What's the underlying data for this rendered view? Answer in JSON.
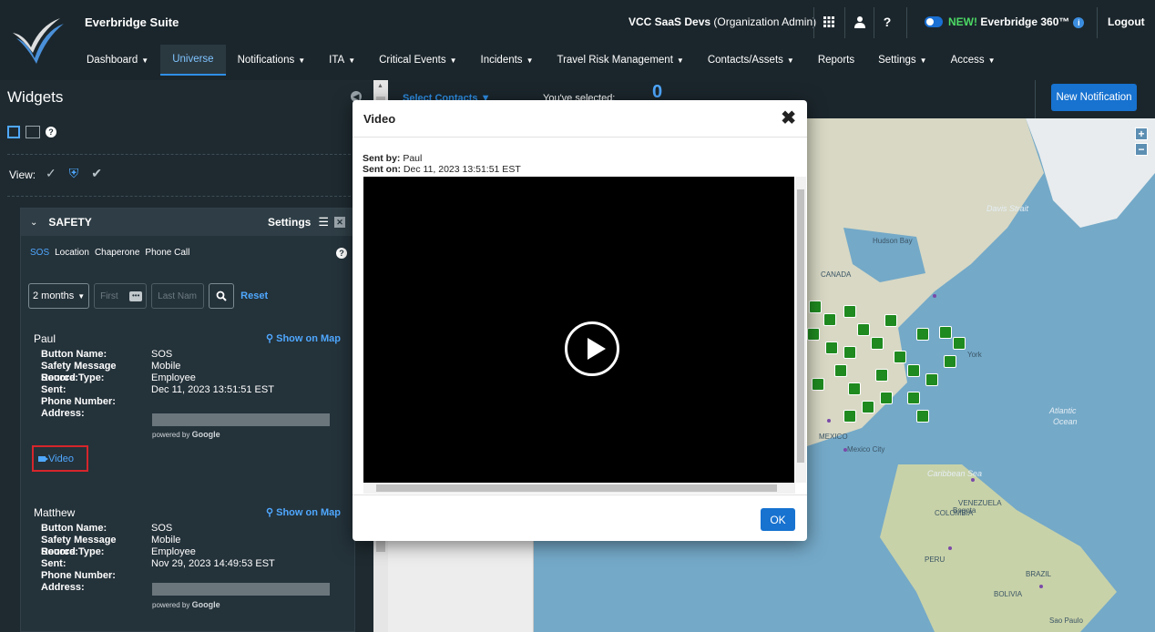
{
  "header": {
    "suite": "Everbridge Suite",
    "org_name": "VCC SaaS Devs",
    "org_role": "(Organization Admin)",
    "new_label": "NEW!",
    "product_360": "Everbridge 360™",
    "logout": "Logout"
  },
  "nav": {
    "items": [
      {
        "label": "Dashboard",
        "caret": true
      },
      {
        "label": "Universe",
        "caret": false,
        "active": true
      },
      {
        "label": "Notifications",
        "caret": true
      },
      {
        "label": "ITA",
        "caret": true
      },
      {
        "label": "Critical Events",
        "caret": true
      },
      {
        "label": "Incidents",
        "caret": true
      },
      {
        "label": "Travel Risk Management",
        "caret": true
      },
      {
        "label": "Contacts/Assets",
        "caret": true
      },
      {
        "label": "Reports",
        "caret": false
      },
      {
        "label": "Settings",
        "caret": true
      },
      {
        "label": "Access",
        "caret": true
      }
    ]
  },
  "widgets": {
    "title": "Widgets",
    "view_label": "View:"
  },
  "safety": {
    "title": "SAFETY",
    "settings": "Settings",
    "tabs": [
      "SOS",
      "Location",
      "Chaperone",
      "Phone Call"
    ],
    "period": "2 months",
    "first_placeholder": "First",
    "last_placeholder": "Last Nam",
    "reset": "Reset",
    "show_on_map": "Show on Map",
    "powered_by": "powered by",
    "powered_brand": "Google",
    "video_label": "Video",
    "field_labels": {
      "button_name": "Button Name:",
      "source": "Safety Message Source:",
      "record_type": "Record Type:",
      "sent": "Sent:",
      "phone": "Phone Number:",
      "address": "Address:"
    },
    "entries": [
      {
        "name": "Paul",
        "button_name": "SOS",
        "source": "Mobile",
        "record_type": "Employee",
        "sent": "Dec 11, 2023 13:51:51 EST"
      },
      {
        "name": "Matthew",
        "button_name": "SOS",
        "source": "Mobile",
        "record_type": "Employee",
        "sent": "Nov 29, 2023 14:49:53 EST"
      }
    ]
  },
  "main": {
    "select_contacts": "Select Contacts",
    "youve_selected": "You've selected:",
    "selected_count": "0",
    "new_notification": "New Notification"
  },
  "map": {
    "labels": {
      "davis_strait": "Davis Strait",
      "hudson_bay": "Hudson Bay",
      "canada": "CANADA",
      "york": "York",
      "atlantic": "Atlantic",
      "ocean": "Ocean",
      "mexico": "MEXICO",
      "mexico_city": "Mexico City",
      "caribbean": "Caribbean Sea",
      "venezuela": "VENEZUELA",
      "bogota": "Bogota",
      "colombia": "COLOMBIA",
      "peru": "PERU",
      "brazil": "BRAZIL",
      "bolivia": "BOLIVIA",
      "sao_paulo": "Sao Paulo"
    }
  },
  "modal": {
    "title": "Video",
    "sent_by_label": "Sent by:",
    "sent_by": "Paul",
    "sent_on_label": "Sent on:",
    "sent_on": "Dec 11, 2023 13:51:51 EST",
    "ok": "OK"
  },
  "colors": {
    "accent": "#1772d0",
    "link": "#4fa8ff",
    "highlight_border": "#d6262b",
    "pin_green": "#1f8a1f"
  }
}
